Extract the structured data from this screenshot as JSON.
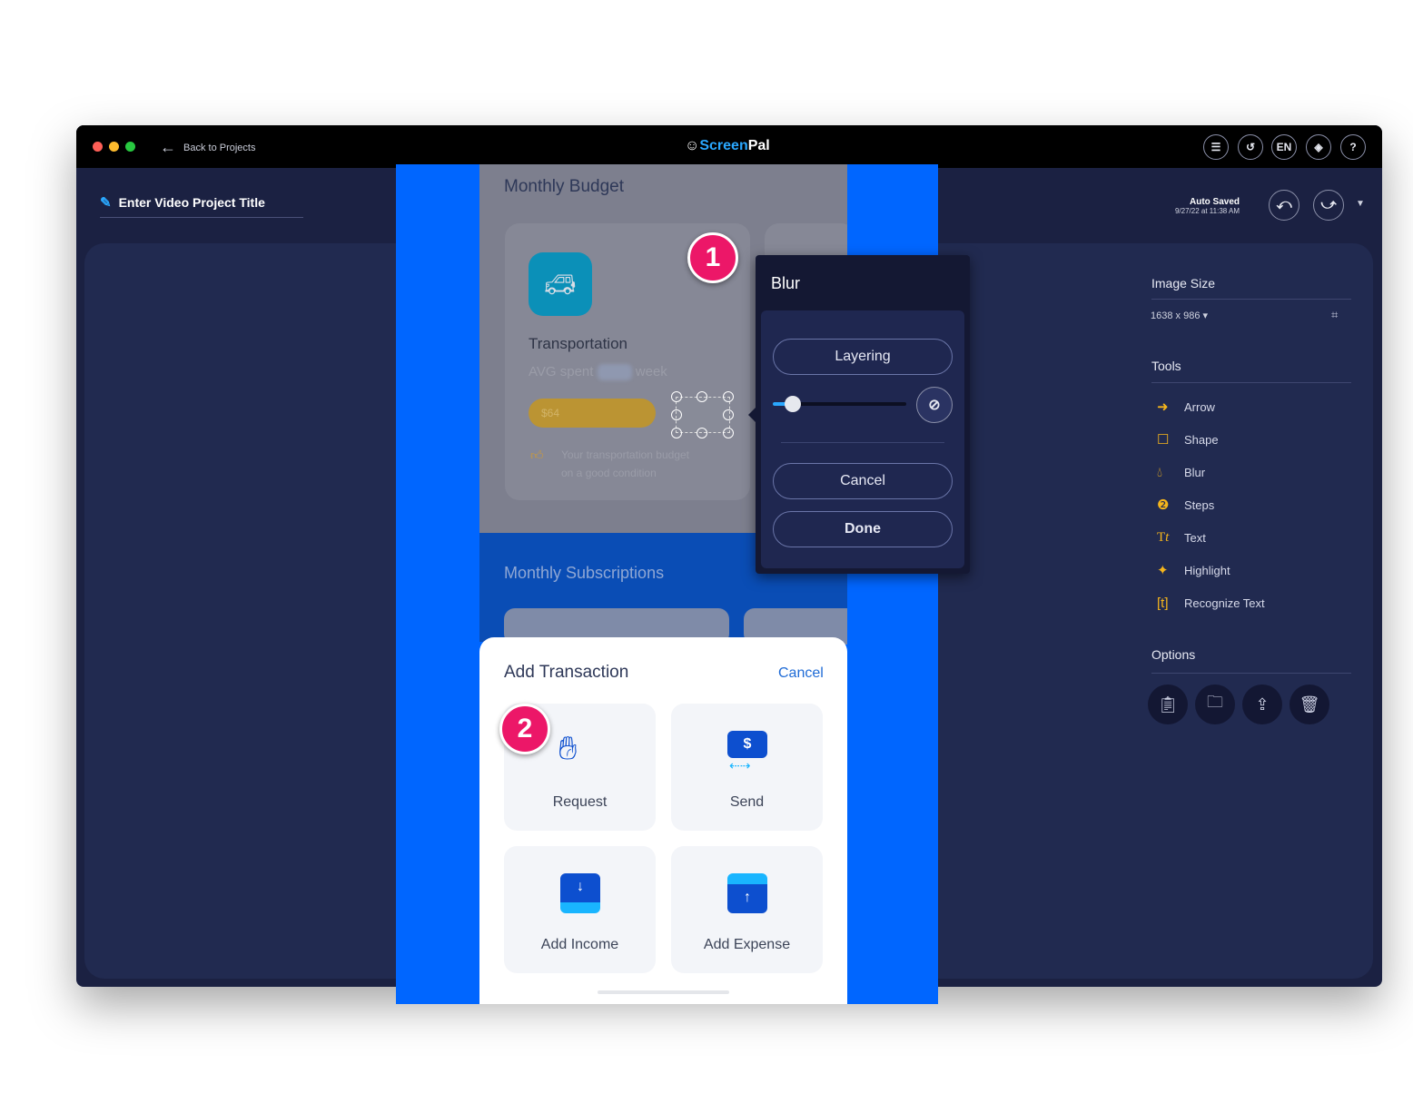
{
  "titlebar": {
    "back_label": "Back to  Projects",
    "app_name_part1": "Screen",
    "app_name_part2": "Pal",
    "lang": "EN",
    "help": "?"
  },
  "project": {
    "title": "Enter Video Project Title",
    "saved_label": "Auto Saved",
    "saved_time": "9/27/22 at 11:38 AM"
  },
  "sidebar": {
    "image_size_label": "Image Size",
    "image_size_value": "1638 x 986",
    "tools_label": "Tools",
    "tools": [
      {
        "label": "Arrow",
        "icon": "arrow-icon"
      },
      {
        "label": "Shape",
        "icon": "square-icon"
      },
      {
        "label": "Blur",
        "icon": "drop-icon"
      },
      {
        "label": "Steps",
        "icon": "steps-icon"
      },
      {
        "label": "Text",
        "icon": "text-icon"
      },
      {
        "label": "Highlight",
        "icon": "sparkle-icon"
      },
      {
        "label": "Recognize Text",
        "icon": "ocr-icon"
      }
    ],
    "options_label": "Options",
    "options": [
      "clipboard-icon",
      "folder-icon",
      "upload-icon",
      "trash-icon"
    ]
  },
  "blur_panel": {
    "title": "Blur",
    "layering": "Layering",
    "cancel": "Cancel",
    "done": "Done",
    "slider_value": 0.15
  },
  "canvas": {
    "monthly_budget": "Monthly Budget",
    "category": "Transportation",
    "avg_prefix": "AVG spent",
    "avg_suffix": "week",
    "bar_value": "$64",
    "note_line1": "Your transportation budget",
    "note_line2": "on a good condition",
    "subscriptions": "Monthly Subscriptions",
    "sheet_title": "Add Transaction",
    "sheet_cancel": "Cancel",
    "tiles": [
      "Request",
      "Send",
      "Add Income",
      "Add Expense"
    ],
    "steps": [
      "1",
      "2"
    ]
  },
  "colors": {
    "accent": "#f5b51c",
    "step": "#ec1768",
    "canvas_blue": "#0066ff",
    "brand_blue": "#2aa8ff"
  }
}
